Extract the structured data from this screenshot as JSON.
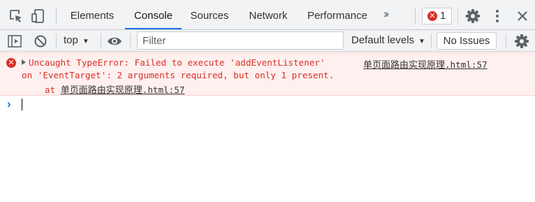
{
  "tabs": [
    {
      "label": "Elements"
    },
    {
      "label": "Console"
    },
    {
      "label": "Sources"
    },
    {
      "label": "Network"
    },
    {
      "label": "Performance"
    }
  ],
  "active_tab": "Console",
  "error_count": "1",
  "toolbar": {
    "context": "top",
    "filter_placeholder": "Filter",
    "levels": "Default levels",
    "issues": "No Issues"
  },
  "console": {
    "error": {
      "line1": "Uncaught TypeError: Failed to execute 'addEventListener'",
      "line2": "on 'EventTarget': 2 arguments required, but only 1 present.",
      "stack_prefix": "at ",
      "source_name": "单页面路由实现原理",
      "source_loc": ".html:57"
    }
  },
  "colors": {
    "accent": "#1a73e8",
    "error": "#d93025",
    "error_bg": "#fef0ef"
  }
}
